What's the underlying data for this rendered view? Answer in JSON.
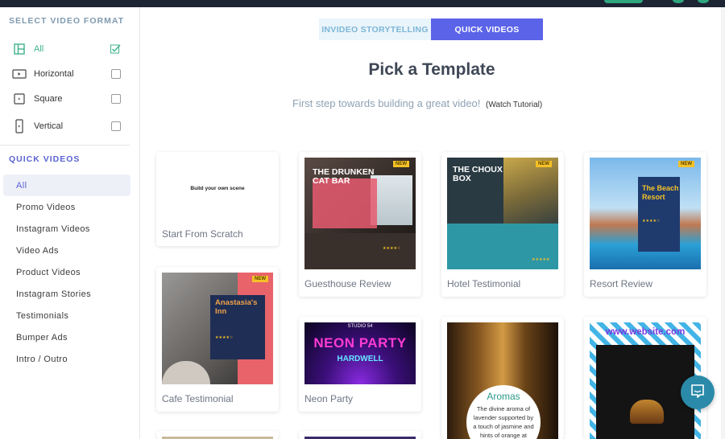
{
  "sidebar": {
    "format_title": "SELECT VIDEO FORMAT",
    "formats": [
      {
        "label": "All",
        "checked": true,
        "icon": "layout-icon"
      },
      {
        "label": "Horizontal",
        "checked": false,
        "icon": "horizontal-video-icon"
      },
      {
        "label": "Square",
        "checked": false,
        "icon": "square-video-icon"
      },
      {
        "label": "Vertical",
        "checked": false,
        "icon": "vertical-video-icon"
      }
    ],
    "quick_title": "QUICK VIDEOS",
    "quick_items": [
      "All",
      "Promo Videos",
      "Instagram Videos",
      "Video Ads",
      "Product Videos",
      "Instagram Stories",
      "Testimonials",
      "Bumper Ads",
      "Intro / Outro"
    ]
  },
  "tabs": {
    "storytelling": "INVIDEO STORYTELLING",
    "quick": "QUICK VIDEOS",
    "active": "quick"
  },
  "main": {
    "title": "Pick a Template",
    "subtitle": "First step towards building a great video!",
    "watch_tutorial": "(Watch Tutorial)"
  },
  "cards": {
    "scratch": {
      "caption": "Start From Scratch",
      "inner": "Build your own scene"
    },
    "guesthouse": {
      "caption": "Guesthouse Review",
      "heading": "THE DRUNKEN CAT BAR",
      "badge": "NEW"
    },
    "hotel": {
      "caption": "Hotel Testimonial",
      "heading": "THE CHOUX BOX",
      "badge": "NEW"
    },
    "resort": {
      "caption": "Resort Review",
      "heading": "The Beach Resort",
      "badge": "NEW"
    },
    "cafe": {
      "caption": "Cafe Testimonial",
      "heading": "Anastasia's Inn",
      "badge": "NEW"
    },
    "neon": {
      "caption": "Neon Party",
      "studio": "STUDIO 54",
      "neon1": "NEON PARTY",
      "neon2": "HARDWELL"
    },
    "aromas": {
      "heading": "Aromas",
      "body": "The divine aroma of lavender supported by a touch of jasmine and hints of orange at"
    },
    "website": {
      "url": "www.website.com"
    }
  },
  "colors": {
    "accent": "#5b63e8",
    "accent_light": "#eaf4fb",
    "green": "#3fb28c",
    "chat": "#2b8aa9"
  }
}
